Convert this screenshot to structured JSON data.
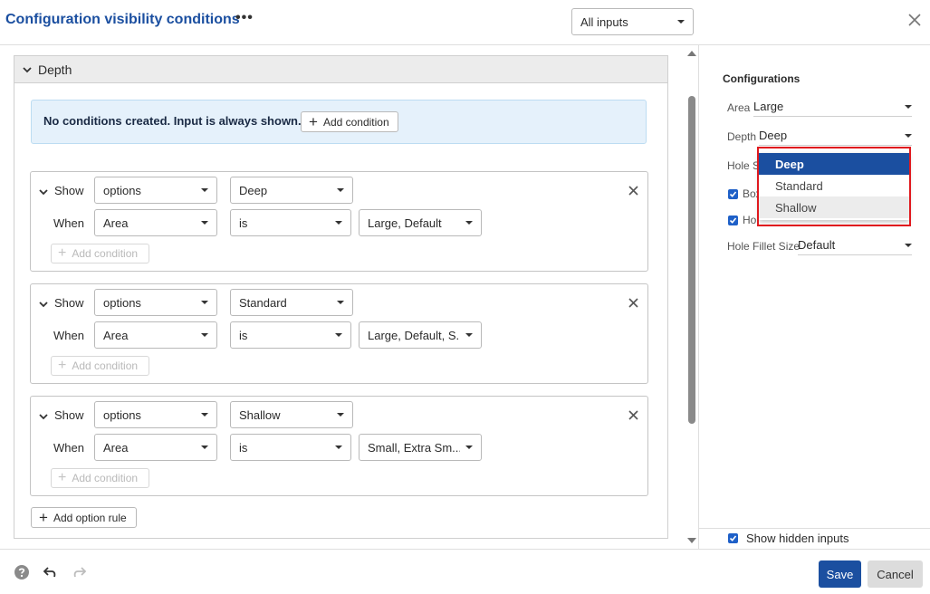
{
  "header": {
    "title": "Configuration visibility conditions",
    "more_label": "•••",
    "filter_value": "All inputs"
  },
  "section": {
    "title": "Depth",
    "notice": "No conditions created. Input is always shown.",
    "add_condition_label": "Add condition"
  },
  "rules": [
    {
      "show_label": "Show",
      "type": "options",
      "option": "Deep",
      "when_label": "When",
      "param": "Area",
      "operator": "is",
      "values": "Large, Default",
      "add_condition_label": "Add condition"
    },
    {
      "show_label": "Show",
      "type": "options",
      "option": "Standard",
      "when_label": "When",
      "param": "Area",
      "operator": "is",
      "values": "Large, Default, S...",
      "add_condition_label": "Add condition"
    },
    {
      "show_label": "Show",
      "type": "options",
      "option": "Shallow",
      "when_label": "When",
      "param": "Area",
      "operator": "is",
      "values": "Small, Extra Sm...",
      "add_condition_label": "Add condition"
    }
  ],
  "add_option_rule_label": "Add option rule",
  "configurations": {
    "title": "Configurations",
    "area_label": "Area",
    "area_value": "Large",
    "depth_label": "Depth",
    "depth_value": "Deep",
    "hole_size_label": "Hole Si",
    "box_label": "Box",
    "hole_label": "Hol",
    "fillet_label": "Hole Fillet Size",
    "fillet_value": "Default",
    "dropdown_options": [
      "Deep",
      "Standard",
      "Shallow"
    ],
    "dropdown_selected": "Deep",
    "show_hidden_label": "Show hidden inputs"
  },
  "footer": {
    "save_label": "Save",
    "cancel_label": "Cancel"
  },
  "colors": {
    "accent": "#1b4fa0",
    "highlight_outline": "#e0191e"
  }
}
